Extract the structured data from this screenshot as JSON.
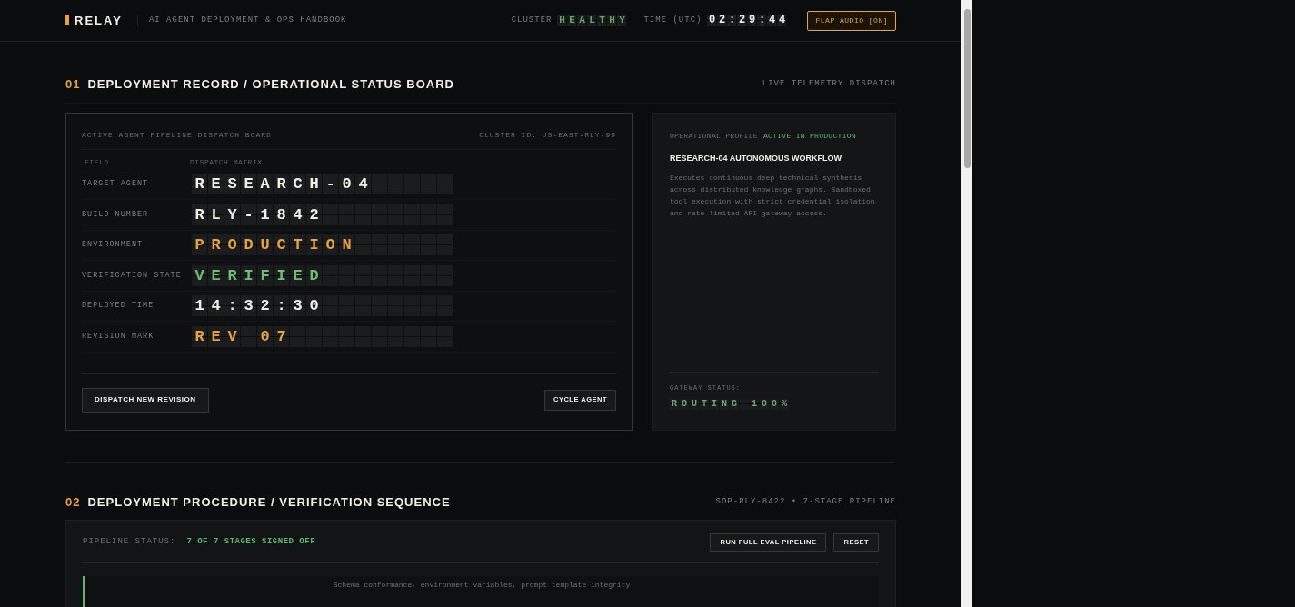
{
  "header": {
    "logo": "RELAY",
    "subtitle": "AI AGENT DEPLOYMENT & OPS HANDBOOK",
    "cluster_label": "CLUSTER",
    "cluster_status": "HEALTHY",
    "time_label": "TIME (UTC)",
    "time": "02:29:44",
    "audio_button": "FLAP AUDIO [ON]"
  },
  "section_1": {
    "number": "01",
    "title": "DEPLOYMENT RECORD / OPERATIONAL STATUS BOARD",
    "meta": "LIVE TELEMETRY DISPATCH",
    "board": {
      "title": "ACTIVE AGENT PIPELINE DISPATCH BOARD",
      "cluster_id": "CLUSTER ID: US-EAST-RLY-99",
      "columns": [
        "FIELD",
        "DISPATCH MATRIX"
      ],
      "rows": [
        {
          "label": "TARGET AGENT",
          "value": "RESEARCH-04",
          "color": "#f2efe6"
        },
        {
          "label": "BUILD NUMBER",
          "value": "RLY-1842",
          "color": "#f2efe6"
        },
        {
          "label": "ENVIRONMENT",
          "value": "PRODUCTION",
          "color": "#e8a33d"
        },
        {
          "label": "VERIFICATION STATE",
          "value": "VERIFIED",
          "color": "#6fbf73"
        },
        {
          "label": "DEPLOYED TIME",
          "value": "14:32:30",
          "color": "#f2efe6"
        },
        {
          "label": "REVISION MARK",
          "value": "REV 07",
          "color": "#e8a33d"
        }
      ],
      "primary_button": "DISPATCH NEW REVISION",
      "secondary_button": "CYCLE AGENT"
    },
    "profile": {
      "label": "OPERATIONAL PROFILE",
      "status": "ACTIVE IN PRODUCTION",
      "title": "RESEARCH-04 AUTONOMOUS WORKFLOW",
      "description": "Executes continuous deep technical synthesis across distributed knowledge graphs. Sandboxed tool execution with strict credential isolation and rate-limited API gateway access.",
      "gateway_label": "GATEWAY STATUS:",
      "gateway_value": "ROUTING 100%"
    }
  },
  "section_2": {
    "number": "02",
    "title": "DEPLOYMENT PROCEDURE / VERIFICATION SEQUENCE",
    "meta": "SOP-RLY-8422 • 7-STAGE PIPELINE",
    "pipeline": {
      "status_label": "PIPELINE STATUS:",
      "status_value": "7 OF 7 STAGES SIGNED OFF",
      "run_button": "RUN FULL EVAL PIPELINE",
      "reset_button": "RESET",
      "stages": [
        {
          "text": "Schema conformance, environment variables, prompt template integrity"
        }
      ]
    }
  }
}
